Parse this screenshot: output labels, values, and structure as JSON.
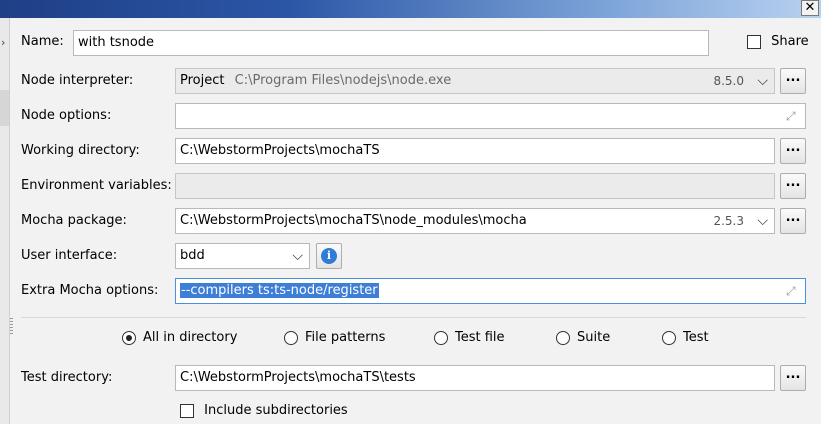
{
  "window": {
    "close_glyph": "✕"
  },
  "name": {
    "label": "Name:",
    "value": "with tsnode"
  },
  "share": {
    "label": "Share",
    "checked": false
  },
  "node_interpreter": {
    "label": "Node interpreter:",
    "kind": "Project",
    "path": "C:\\Program Files\\nodejs\\node.exe",
    "version": "8.5.0"
  },
  "node_options": {
    "label": "Node options:",
    "value": ""
  },
  "working_directory": {
    "label": "Working directory:",
    "value": "C:\\WebstormProjects\\mochaTS"
  },
  "environment_variables": {
    "label": "Environment variables:",
    "value": ""
  },
  "mocha_package": {
    "label": "Mocha package:",
    "value": "C:\\WebstormProjects\\mochaTS\\node_modules\\mocha",
    "version": "2.5.3"
  },
  "user_interface": {
    "label": "User interface:",
    "value": "bdd"
  },
  "extra_mocha_options": {
    "label": "Extra Mocha options:",
    "value": "--compilers ts:ts-node/register"
  },
  "test_kind": {
    "options": [
      {
        "label": "All in directory",
        "selected": true
      },
      {
        "label": "File patterns",
        "selected": false
      },
      {
        "label": "Test file",
        "selected": false
      },
      {
        "label": "Suite",
        "selected": false
      },
      {
        "label": "Test",
        "selected": false
      }
    ]
  },
  "test_directory": {
    "label": "Test directory:",
    "value": "C:\\WebstormProjects\\mochaTS\\tests"
  },
  "include_subdirectories": {
    "label": "Include subdirectories",
    "checked": false
  },
  "browse_label": "...",
  "icons": {
    "dropdown": "chevron-down-icon",
    "expand": "expand-icon",
    "info": "info-icon",
    "close": "close-icon"
  }
}
